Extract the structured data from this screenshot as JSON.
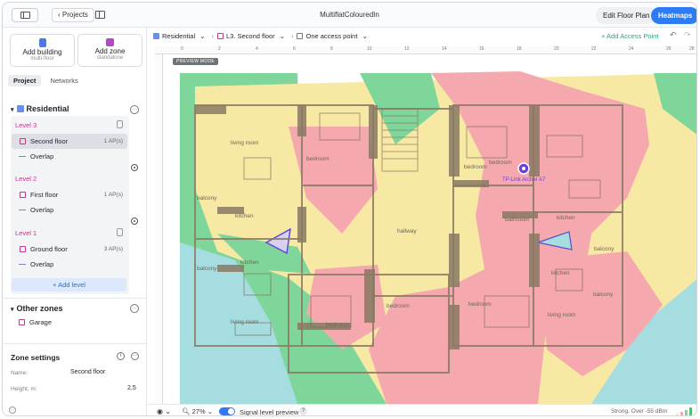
{
  "titlebar": {
    "projects_label": "‹ Projects",
    "title": "MultiflatColouredIn",
    "edit_floor_plan": "Edit Floor Plan",
    "heatmaps": "Heatmaps ›"
  },
  "sidebar": {
    "add_building": {
      "title": "Add building",
      "subtitle": "multi-floor"
    },
    "add_zone": {
      "title": "Add zone",
      "subtitle": "standalone"
    },
    "tabs": [
      {
        "label": "Project"
      },
      {
        "label": "Networks"
      }
    ],
    "building": {
      "name": "Residential",
      "menu": "···"
    },
    "levels": [
      {
        "label": "Level 3",
        "floor": "Second floor",
        "aps": "1 AP(s)",
        "overlay": "Overlap"
      },
      {
        "label": "Level 2",
        "floor": "First floor",
        "aps": "1 AP(s)",
        "overlay": "Overlap"
      },
      {
        "label": "Level 1",
        "floor": "Ground floor",
        "aps": "3 AP(s)",
        "overlay": "Overlap"
      }
    ],
    "add_level": "+ Add level",
    "other_zones": {
      "title": "Other zones",
      "menu": "···",
      "items": [
        {
          "name": "Garage"
        }
      ]
    },
    "zone_settings": {
      "title": "Zone settings",
      "info": "i",
      "menu": "···",
      "name_label": "Name:",
      "name_value": "Second floor",
      "height_label": "Height, m:",
      "height_value": "2,5"
    }
  },
  "toolbar": {
    "breadcrumb": [
      "Residential",
      "L3. Second floor",
      "One access point"
    ],
    "add_access_point": "+ Add Access Point",
    "undo": "↶",
    "redo": "↷"
  },
  "ruler": {
    "ticks": [
      "0",
      "2",
      "4",
      "6",
      "8",
      "10",
      "12",
      "14",
      "16",
      "18",
      "20",
      "22",
      "24",
      "26",
      "28"
    ]
  },
  "canvas": {
    "preview_badge": "PREVIEW MODE",
    "rooms": [
      "living room",
      "bedroom",
      "bedroom",
      "bedroom",
      "balcony",
      "kitchen",
      "hallway",
      "kitchen",
      "balcony",
      "bathroom",
      "kitchen",
      "living room",
      "bedroom",
      "bedroom",
      "bedroom",
      "living room",
      "balcony",
      "kitchen",
      "balcony"
    ],
    "ap_label": "TP-Link Archer A7"
  },
  "bottombar": {
    "zoom": "27% ⌄",
    "signal_label": "Signal level preview",
    "help": "?",
    "legend": "Strong. Over -55 dBm"
  },
  "colors": {
    "accent": "#2d7cf6",
    "add_ap": "#2aa572",
    "level_label": "#c4368a",
    "heat_yellow": "#f7e8a4",
    "heat_red": "#f5a8ae",
    "heat_green": "#7fd69a",
    "heat_blue": "#a5dde0"
  }
}
